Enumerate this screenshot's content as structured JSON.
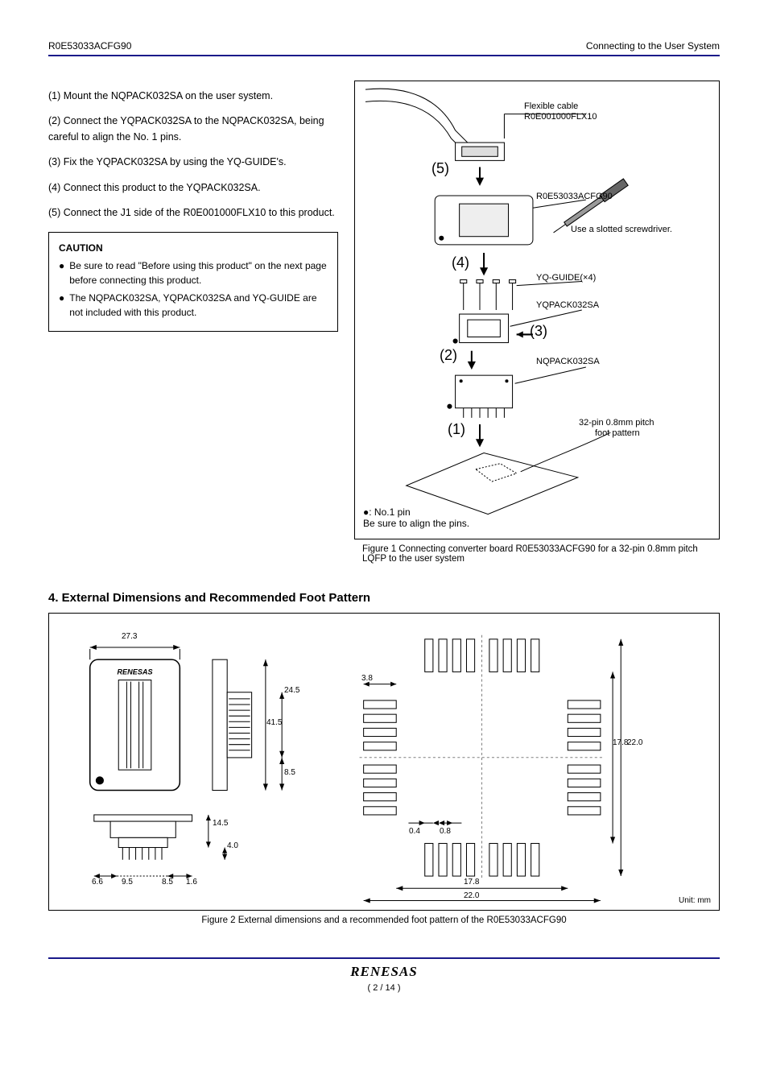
{
  "header": {
    "left": "R0E53033ACFG90",
    "right": "Connecting to the User System"
  },
  "steps": {
    "s1": "(1) Mount the NQPACK032SA on the user system.",
    "s2": "(2) Connect the YQPACK032SA to the NQPACK032SA, being careful to align the No. 1 pins.",
    "s3": "(3) Fix the YQPACK032SA by using the YQ-GUIDE's.",
    "s4": "(4) Connect this product to the YQPACK032SA.",
    "s5": "(5) Connect the J1 side of the R0E001000FLX10 to this product."
  },
  "caution": {
    "title": "CAUTION",
    "b1": "Be sure to read \"Before using this product\" on the next page before connecting this product.",
    "b2": "The NQPACK032SA, YQPACK032SA and YQ-GUIDE are not included with this product."
  },
  "fig1": {
    "flexcable_label": "Flexible cable",
    "flexcable_part": "R0E001000FLX10",
    "board_part": "R0E53033ACFG90",
    "screwdriver": "Use a slotted screwdriver.",
    "yqguide": "YQ-GUIDE(×4)",
    "yqpack": "YQPACK032SA",
    "nqpack": "NQPACK032SA",
    "footpattern1": "32-pin 0.8mm pitch",
    "footpattern2": "foot pattern",
    "s1": "(1)",
    "s2": "(2)",
    "s3": "(3)",
    "s4": "(4)",
    "s5": "(5)",
    "note1": "●: No.1 pin",
    "note2": "Be sure to align the pins.",
    "caption": "Figure 1    Connecting converter board R0E53033ACFG90 for a 32-pin 0.8mm pitch LQFP to the user system"
  },
  "dim": {
    "heading": "4. External Dimensions and Recommended Foot Pattern",
    "d_27_3": "27.3",
    "d_24_5": "24.5",
    "d_41_5": "41.5",
    "d_8_5": "8.5",
    "d_6_6": "6.6",
    "d_8_5b": "8.5",
    "d_4_0": "4.0",
    "d_14_5": "14.5",
    "d_9_5": "9.5",
    "d_1_6": "1.6",
    "d_3_8": "3.8",
    "d_22_0": "22.0",
    "d_0_4": "0.4",
    "d_0_8": "0.8",
    "d_17_8": "17.8",
    "d_22_0b": "22.0",
    "d_17_8b": "17.8",
    "unit": "Unit: mm",
    "caption": "Figure 2    External dimensions and a recommended foot pattern of the R0E53033ACFG90"
  },
  "footer": {
    "logo": "RENESAS",
    "page": "( 2 / 14 )"
  }
}
